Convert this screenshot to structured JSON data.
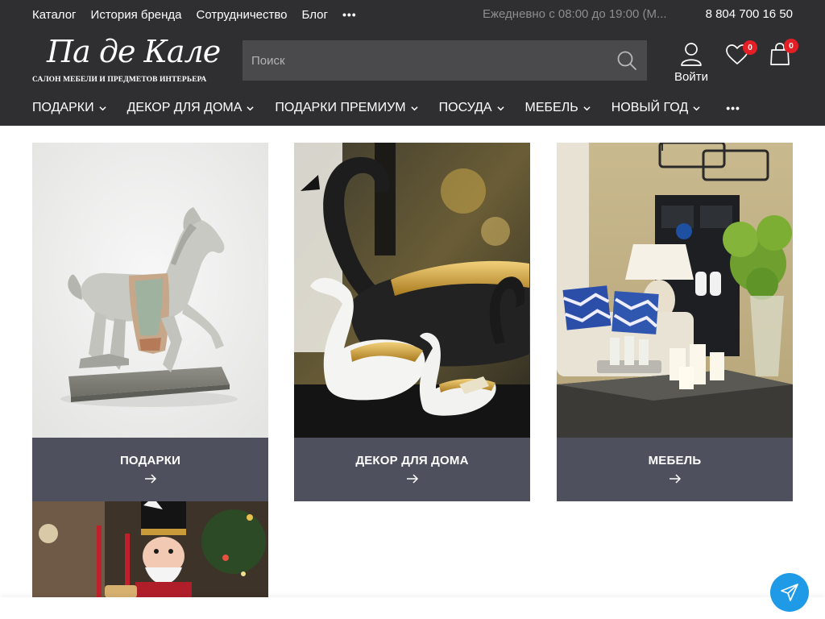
{
  "topbar": {
    "links": [
      "Каталог",
      "История бренда",
      "Сотрудничество",
      "Блог"
    ],
    "more": "•••",
    "hours": "Ежедневно с 08:00 до 19:00 (М...",
    "phone": "8 804 700 16 50"
  },
  "logo": {
    "main": "Па де Кале",
    "sub": "САЛОН МЕБЕЛИ И ПРЕДМЕТОВ ИНТЕРЬЕРА"
  },
  "search": {
    "placeholder": "Поиск"
  },
  "account": {
    "label": "Войти"
  },
  "favorites": {
    "count": "0"
  },
  "cart": {
    "count": "0"
  },
  "main_nav": {
    "items": [
      "ПОДАРКИ",
      "ДЕКОР ДЛЯ ДОМА",
      "ПОДАРКИ ПРЕМИУМ",
      "ПОСУДА",
      "МЕБЕЛЬ",
      "НОВЫЙ ГОД"
    ],
    "more": "•••"
  },
  "categories": [
    {
      "title": "ПОДАРКИ",
      "image": "horse-figurine"
    },
    {
      "title": "ДЕКОР ДЛЯ ДОМА",
      "image": "swan-bowls"
    },
    {
      "title": "МЕБЕЛЬ",
      "image": "living-room"
    },
    {
      "title": "",
      "image": "nutcracker"
    }
  ],
  "colors": {
    "header_bg": "#2f2f31",
    "caption_bg": "#4f505d",
    "badge": "#e31e24",
    "telegram": "#1e9ae6"
  }
}
